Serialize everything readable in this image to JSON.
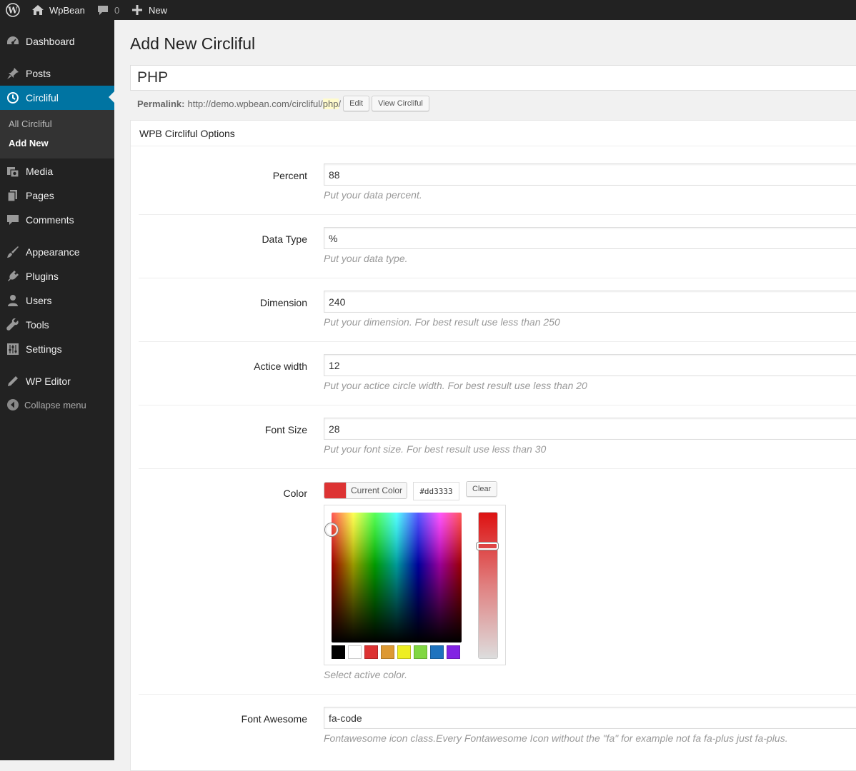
{
  "adminbar": {
    "site_name": "WpBean",
    "comments_count": "0",
    "new_label": "New"
  },
  "sidebar": {
    "items": [
      {
        "label": "Dashboard",
        "icon": "dashboard-icon"
      },
      {
        "label": "Posts",
        "icon": "pin-icon"
      },
      {
        "label": "Circliful",
        "icon": "clock-icon",
        "current": true
      },
      {
        "label": "Media",
        "icon": "media-icon"
      },
      {
        "label": "Pages",
        "icon": "pages-icon"
      },
      {
        "label": "Comments",
        "icon": "comment-icon"
      },
      {
        "label": "Appearance",
        "icon": "brush-icon"
      },
      {
        "label": "Plugins",
        "icon": "plug-icon"
      },
      {
        "label": "Users",
        "icon": "user-icon"
      },
      {
        "label": "Tools",
        "icon": "wrench-icon"
      },
      {
        "label": "Settings",
        "icon": "sliders-icon"
      },
      {
        "label": "WP Editor",
        "icon": "pencil-icon"
      }
    ],
    "submenu": [
      {
        "label": "All Circliful"
      },
      {
        "label": "Add New",
        "current": true
      }
    ],
    "collapse_label": "Collapse menu"
  },
  "main": {
    "page_title": "Add New Circliful",
    "post_title": "PHP",
    "permalink": {
      "label": "Permalink:",
      "base": "http://demo.wpbean.com/circliful/",
      "slug": "php",
      "trail": "/",
      "edit_label": "Edit",
      "view_label": "View Circliful"
    },
    "metabox_title": "WPB Circliful Options",
    "fields": [
      {
        "label": "Percent",
        "value": "88",
        "desc": "Put your data percent."
      },
      {
        "label": "Data Type",
        "value": "%",
        "desc": "Put your data type."
      },
      {
        "label": "Dimension",
        "value": "240",
        "desc": "Put your dimension. For best result use less than 250"
      },
      {
        "label": "Actice width",
        "value": "12",
        "desc": "Put your actice circle width. For best result use less than 20"
      },
      {
        "label": "Font Size",
        "value": "28",
        "desc": "Put your font size. For best result use less than 30"
      }
    ],
    "color": {
      "label": "Color",
      "current_label": "Current Color",
      "hex": "#dd3333",
      "clear_label": "Clear",
      "desc": "Select active color.",
      "palette": [
        "#000000",
        "#ffffff",
        "#dd3333",
        "#dd9933",
        "#eeee22",
        "#81d742",
        "#1e73be",
        "#8224e3"
      ]
    },
    "font_awesome": {
      "label": "Font Awesome",
      "value": "fa-code",
      "desc": "Fontawesome icon class.Every Fontawesome Icon without the \"fa\" for example not fa fa-plus just fa-plus."
    }
  },
  "colors": {
    "accent": "#0074a2",
    "sidebar_bg": "#222222",
    "submenu_bg": "#333333"
  }
}
